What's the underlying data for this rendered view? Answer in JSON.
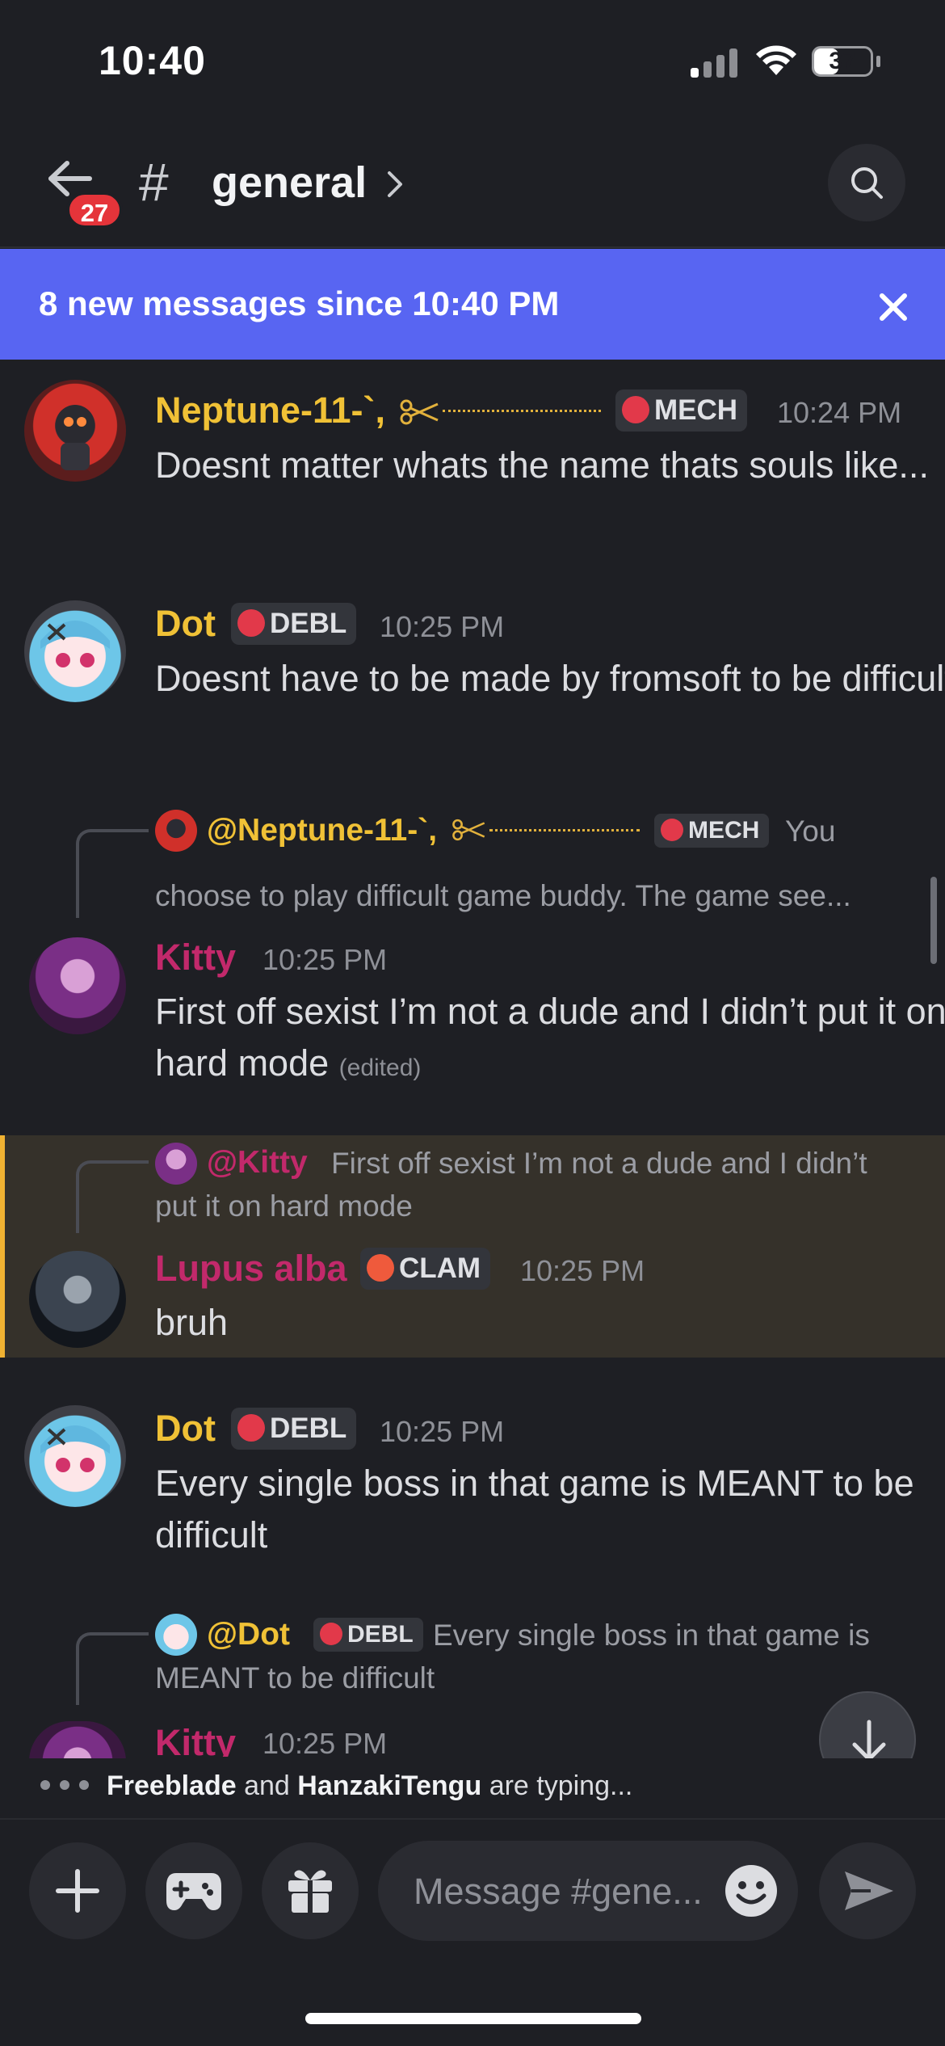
{
  "status_bar": {
    "time": "10:40",
    "battery": "37"
  },
  "header": {
    "unread_count": "27",
    "channel_name": "general"
  },
  "banner": {
    "text": "8 new messages since 10:40 PM"
  },
  "messages": [
    {
      "author": "Neptune-11-`,",
      "author_color": "#f0c136",
      "role": "MECH",
      "time": "10:24 PM",
      "text": "Doesnt matter whats the name thats souls like..."
    },
    {
      "author": "Dot",
      "author_color": "#f0c136",
      "role": "DEBL",
      "time": "10:25 PM",
      "text": "Doesnt have to be made by fromsoft to be difficult"
    },
    {
      "reply": {
        "author": "@Neptune-11-`,",
        "role": "MECH",
        "text_line1": "You",
        "text_line2": "choose to play difficult game buddy. The game see..."
      },
      "author": "Kitty",
      "author_color": "#c2296b",
      "time": "10:25 PM",
      "text": "First off sexist I’m not a dude and I didn’t put it on hard mode",
      "edited": "(edited)"
    },
    {
      "reply": {
        "author": "@Kitty",
        "text_line1": "First off sexist I’m not a dude and I didn’t",
        "text_line2": "put it on hard mode"
      },
      "author": "Lupus alba",
      "author_color": "#c2296b",
      "role": "CLAM",
      "time": "10:25 PM",
      "text": "bruh"
    },
    {
      "author": "Dot",
      "author_color": "#f0c136",
      "role": "DEBL",
      "time": "10:25 PM",
      "text": "Every single boss in that game is MEANT to be difficult"
    },
    {
      "reply": {
        "author": "@Dot",
        "role": "DEBL",
        "text_line1": "Every single boss in that game is",
        "text_line2": "MEANT to be difficult"
      },
      "author": "Kitty",
      "author_color": "#c2296b",
      "time": "10:25 PM"
    }
  ],
  "typing": {
    "user1": "Freeblade",
    "and": "and",
    "user2": "HanzakiTengu",
    "suffix": "are typing..."
  },
  "composer": {
    "placeholder": "Message #gene..."
  },
  "colors": {
    "blurple": "#5865f2",
    "mention_highlight": "#f0b232",
    "badge_red": "#e5343a"
  }
}
